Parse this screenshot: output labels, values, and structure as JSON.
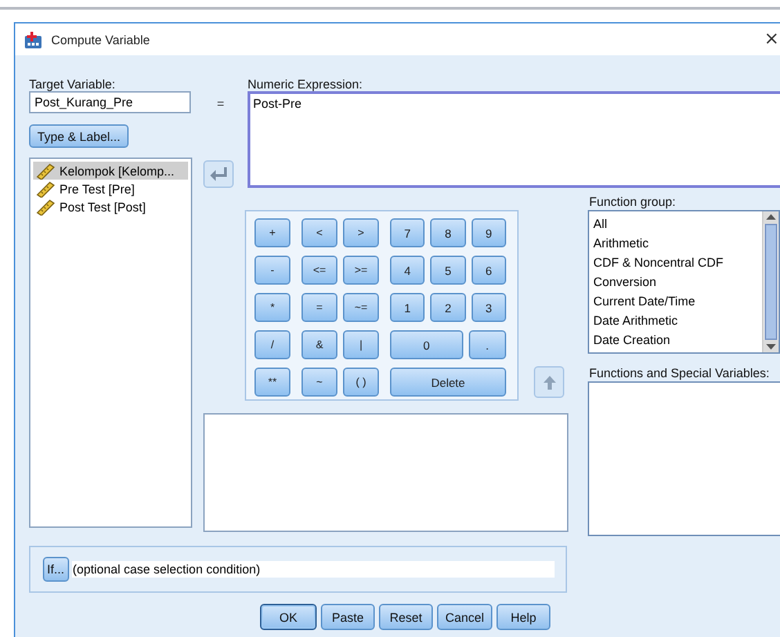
{
  "window": {
    "title": "Compute Variable",
    "close": "×"
  },
  "target_variable": {
    "label": "Target Variable:",
    "value": "Post_Kurang_Pre"
  },
  "type_label_button": "Type & Label...",
  "equals": "=",
  "variables": [
    {
      "name": "Kelompok [Kelomp...",
      "selected": true
    },
    {
      "name": "Pre Test [Pre]",
      "selected": false
    },
    {
      "name": "Post Test [Post]",
      "selected": false
    }
  ],
  "numeric_expression": {
    "label": "Numeric Expression:",
    "value": "Post-Pre"
  },
  "calculator": {
    "rows": [
      {
        "operators": [
          "+"
        ],
        "relations": [
          "<",
          ">"
        ],
        "digits": [
          "7",
          "8",
          "9"
        ]
      },
      {
        "operators": [
          "-"
        ],
        "relations": [
          "<=",
          ">="
        ],
        "digits": [
          "4",
          "5",
          "6"
        ]
      },
      {
        "operators": [
          "*"
        ],
        "relations": [
          "=",
          "~="
        ],
        "digits": [
          "1",
          "2",
          "3"
        ]
      },
      {
        "operators": [
          "/"
        ],
        "relations": [
          "&",
          "|"
        ],
        "digits": [
          "0",
          "."
        ]
      },
      {
        "operators": [
          "**"
        ],
        "relations": [
          "~",
          "( )"
        ],
        "digits": [
          "Delete"
        ]
      }
    ]
  },
  "function_group": {
    "label": "Function group:",
    "items": [
      {
        "name": "All",
        "selected": false
      },
      {
        "name": "Arithmetic",
        "selected": false
      },
      {
        "name": "CDF & Noncentral CDF",
        "selected": false
      },
      {
        "name": "Conversion",
        "selected": false
      },
      {
        "name": "Current Date/Time",
        "selected": false
      },
      {
        "name": "Date Arithmetic",
        "selected": false
      },
      {
        "name": "Date Creation",
        "selected": false
      }
    ]
  },
  "functions_label": "Functions and Special Variables:",
  "if_button": "If...",
  "if_condition": "(optional case selection condition)",
  "buttons": [
    {
      "label": "OK",
      "default": true
    },
    {
      "label": "Paste",
      "default": false
    },
    {
      "label": "Reset",
      "default": false
    },
    {
      "label": "Cancel",
      "default": false
    },
    {
      "label": "Help",
      "default": false
    }
  ]
}
